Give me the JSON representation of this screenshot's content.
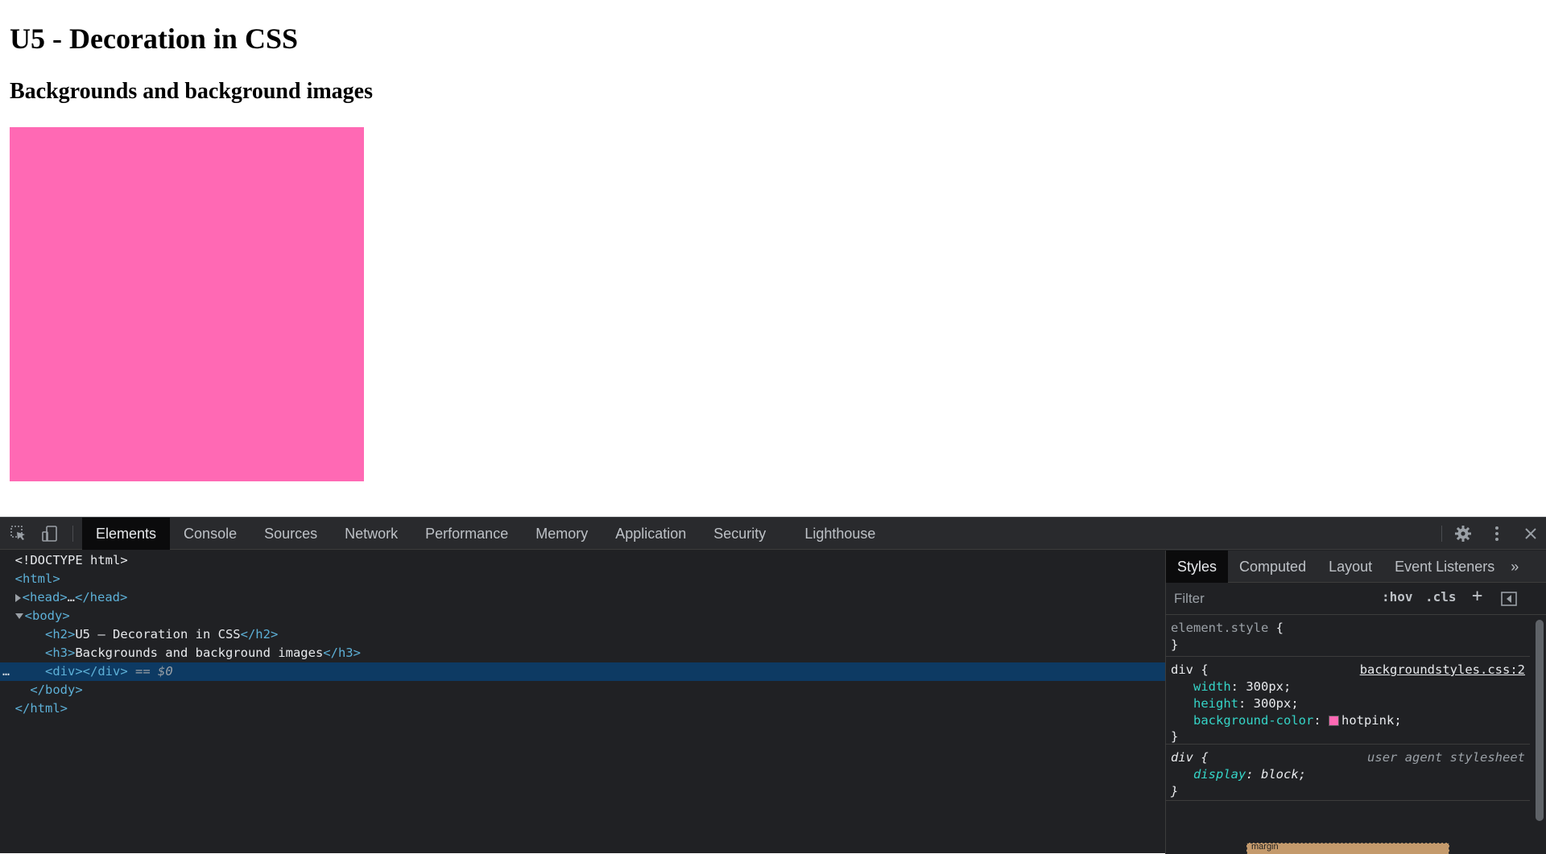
{
  "page": {
    "h2": "U5 - Decoration in CSS",
    "h3": "Backgrounds and background images",
    "box_color": "#ff69b4"
  },
  "devtools": {
    "toolbar_icons": [
      "inspect-element-icon",
      "device-toggle-icon"
    ],
    "tabs": [
      {
        "label": "Elements",
        "active": true
      },
      {
        "label": "Console"
      },
      {
        "label": "Sources"
      },
      {
        "label": "Network"
      },
      {
        "label": "Performance"
      },
      {
        "label": "Memory"
      },
      {
        "label": "Application"
      },
      {
        "label": "Security"
      },
      {
        "label": "Lighthouse"
      }
    ],
    "right_icons": [
      "settings-icon",
      "more-options-icon",
      "close-icon"
    ],
    "dom": {
      "doctype": "<!DOCTYPE html>",
      "html_open": "<html>",
      "head_open": "<head>",
      "head_ellipsis": "…",
      "head_close": "</head>",
      "body_open": "<body>",
      "h2_open": "<h2>",
      "h2_text": "U5 – Decoration in CSS",
      "h2_close": "</h2>",
      "h3_open": "<h3>",
      "h3_text": "Backgrounds and background images",
      "h3_close": "</h3>",
      "div_markup": "<div></div>",
      "div_ref": " == $0",
      "body_close": "</body>",
      "html_close": "</html>",
      "dots": "…"
    },
    "styles": {
      "tabs": [
        {
          "label": "Styles",
          "active": true
        },
        {
          "label": "Computed"
        },
        {
          "label": "Layout"
        },
        {
          "label": "Event Listeners"
        }
      ],
      "more_tabs": "»",
      "filter_placeholder": "Filter",
      "hov": ":hov",
      "cls": ".cls",
      "add": "+",
      "rules": {
        "element_style": {
          "selector": "element.style",
          "open": " {",
          "close": "}"
        },
        "div_rule": {
          "selector": "div",
          "open": " {",
          "source": "backgroundstyles.css:2",
          "decls": [
            {
              "prop": "width",
              "value": "300px"
            },
            {
              "prop": "height",
              "value": "300px"
            },
            {
              "prop": "background-color",
              "value": "hotpink",
              "swatch": "#ff69b4"
            }
          ],
          "close": "}"
        },
        "ua_rule": {
          "selector": "div",
          "open": " {",
          "source": "user agent stylesheet",
          "decl": {
            "prop": "display",
            "value": "block"
          },
          "close": "}"
        }
      },
      "box_model_label": "margin"
    }
  }
}
